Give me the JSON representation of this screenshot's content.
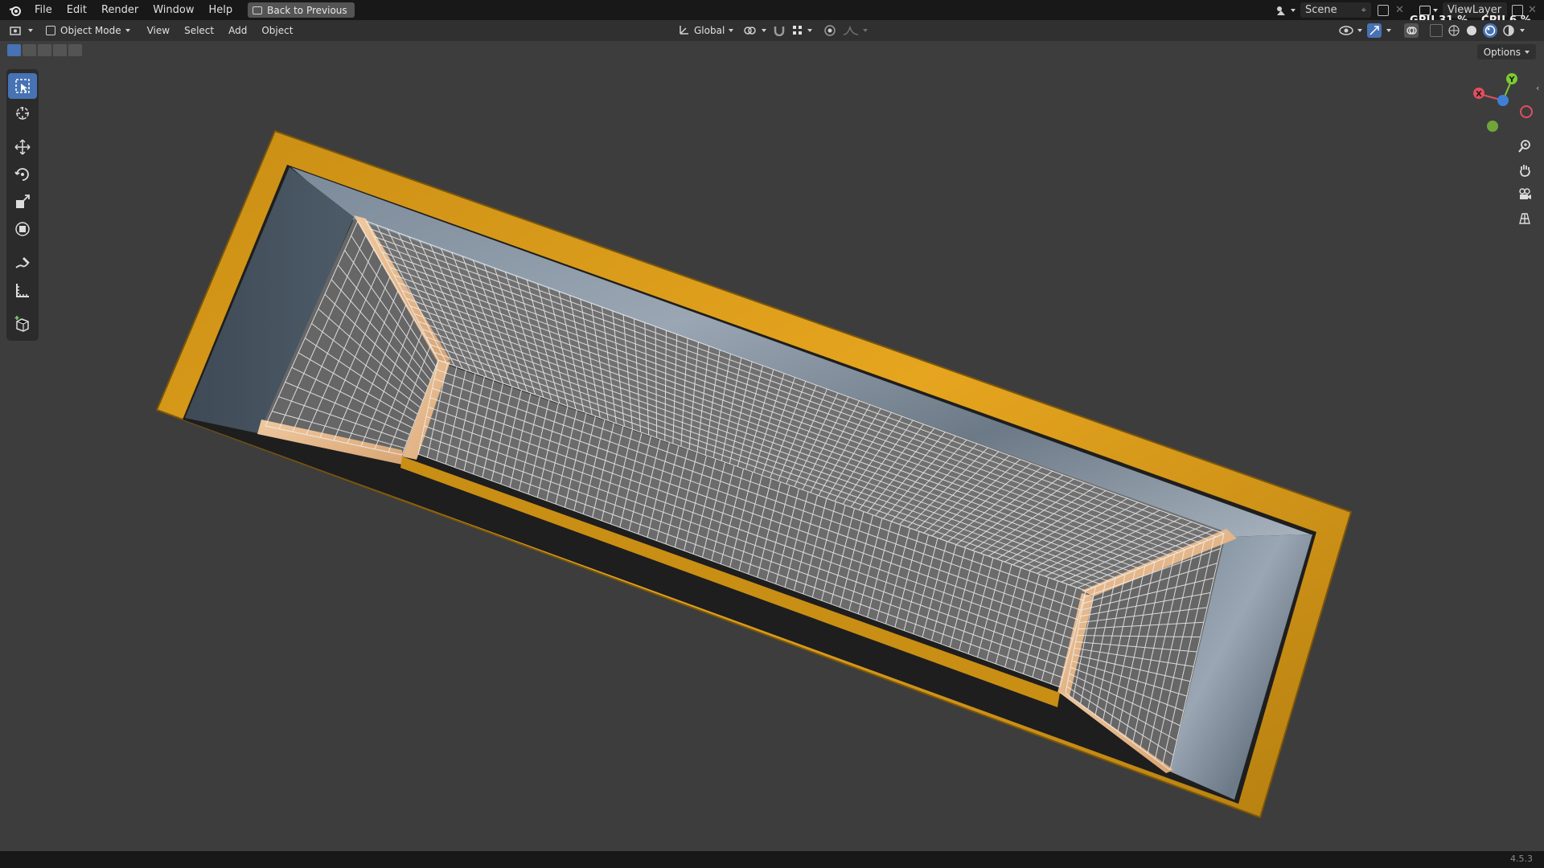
{
  "topbar": {
    "menus": [
      "File",
      "Edit",
      "Render",
      "Window",
      "Help"
    ],
    "back_label": "Back to Previous",
    "scene_name": "Scene",
    "view_layer_name": "ViewLayer",
    "gpu_label": "GPU",
    "gpu_value": "31 %",
    "cpu_label": "CPU",
    "cpu_value": "6 %"
  },
  "header": {
    "mode": "Object Mode",
    "menus": [
      "View",
      "Select",
      "Add",
      "Object"
    ],
    "orientation": "Global"
  },
  "viewport": {
    "options_label": "Options",
    "gizmo_labels": {
      "x": "X",
      "y": "Y"
    },
    "colors": {
      "background": "#3d3d3d",
      "frame": "#e3a11c",
      "net_base": "#6e6e6e",
      "net_line": "#f2f2f2",
      "rock": "#5b6a78",
      "accent_blue": "#4772b3"
    }
  },
  "toolbar": {
    "tools": [
      "select-box",
      "cursor",
      "move",
      "rotate",
      "scale",
      "transform",
      "annotate",
      "measure",
      "add-cube"
    ]
  },
  "statusbar": {
    "version": "4.5.3"
  }
}
